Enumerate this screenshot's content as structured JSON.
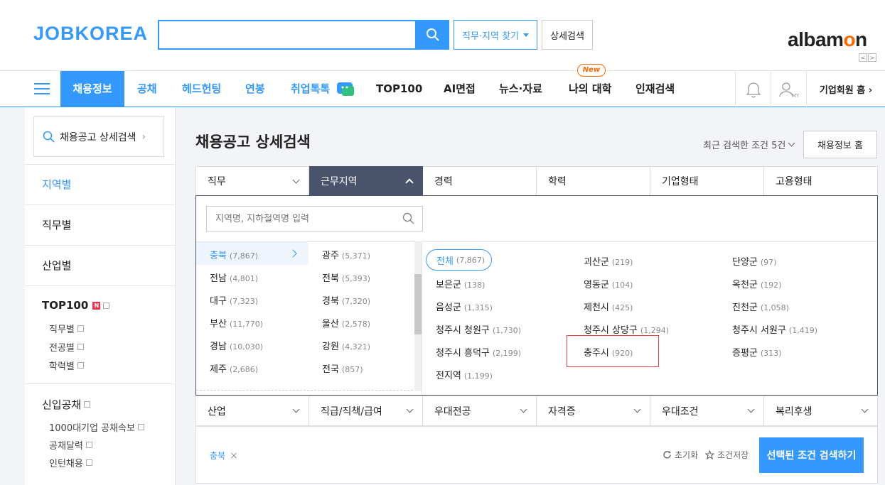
{
  "header": {
    "logo": "JOBKOREA",
    "search": {
      "value": "",
      "placeholder": ""
    },
    "job_region_btn": "직무·지역 찾기",
    "detail_search_btn": "상세검색",
    "partner_logo_pre": "albam",
    "partner_logo_o": "o",
    "partner_logo_post": "n",
    "partner_prev": "<",
    "partner_next": ">"
  },
  "gnb": {
    "items": [
      "채용정보",
      "공채",
      "헤드헌팅",
      "연봉",
      "취업톡톡",
      "TOP100",
      "AI면접",
      "뉴스·자료",
      "나의 대학",
      "인재검색"
    ],
    "new_badge": "New",
    "my_label": "MY",
    "corp_home": "기업회원 홈 ›"
  },
  "sidebar": {
    "search_label": "채용공고 상세검색",
    "by_region": "지역별",
    "by_job": "직무별",
    "by_industry": "산업별",
    "top100": "TOP100",
    "top100_badge": "N",
    "top100_subs": [
      "직무별",
      "전공별",
      "학력별"
    ],
    "newcomer": "신입공채",
    "newcomer_subs": [
      "1000대기업 공채속보",
      "공채달력",
      "인턴채용"
    ]
  },
  "main": {
    "title": "채용공고 상세검색",
    "recent": "최근 검색한 조건 5건",
    "home_btn": "채용정보 홈",
    "tabs": [
      "직무",
      "근무지역",
      "경력",
      "학력",
      "기업형태",
      "고용형태"
    ],
    "tabs2": [
      "산업",
      "직급/직책/급여",
      "우대전공",
      "자격증",
      "우대조건",
      "복리후생"
    ]
  },
  "region_panel": {
    "search_placeholder": "지역명, 지하철역명 입력",
    "provinces_col1": [
      {
        "name": "충북",
        "count": "(7,867)"
      },
      {
        "name": "전남",
        "count": "(4,801)"
      },
      {
        "name": "대구",
        "count": "(7,323)"
      },
      {
        "name": "부산",
        "count": "(11,770)"
      },
      {
        "name": "경남",
        "count": "(10,030)"
      },
      {
        "name": "제주",
        "count": "(2,686)"
      }
    ],
    "provinces_col2": [
      {
        "name": "광주",
        "count": "(5,371)"
      },
      {
        "name": "전북",
        "count": "(5,393)"
      },
      {
        "name": "경북",
        "count": "(7,320)"
      },
      {
        "name": "울산",
        "count": "(2,578)"
      },
      {
        "name": "강원",
        "count": "(4,321)"
      },
      {
        "name": "전국",
        "count": "(857)"
      }
    ],
    "all": {
      "name": "전체",
      "count": "(7,867)"
    },
    "districts": [
      {
        "name": "괴산군",
        "count": "(219)"
      },
      {
        "name": "단양군",
        "count": "(97)"
      },
      {
        "name": "보은군",
        "count": "(138)"
      },
      {
        "name": "영동군",
        "count": "(104)"
      },
      {
        "name": "옥천군",
        "count": "(192)"
      },
      {
        "name": "음성군",
        "count": "(1,315)"
      },
      {
        "name": "제천시",
        "count": "(425)"
      },
      {
        "name": "진천군",
        "count": "(1,058)"
      },
      {
        "name": "청주시 청원구",
        "count": "(1,730)"
      },
      {
        "name": "청주시 상당구",
        "count": "(1,294)"
      },
      {
        "name": "청주시 서원구",
        "count": "(1,419)"
      },
      {
        "name": "청주시 흥덕구",
        "count": "(2,199)"
      },
      {
        "name": "충주시",
        "count": "(920)"
      },
      {
        "name": "증평군",
        "count": "(313)"
      },
      {
        "name": "전지역",
        "count": "(1,199)"
      }
    ]
  },
  "bottom": {
    "chip": "충북",
    "chip_x": "×",
    "reset": "초기화",
    "save": "조건저장",
    "submit": "선택된 조건 검색하기"
  }
}
